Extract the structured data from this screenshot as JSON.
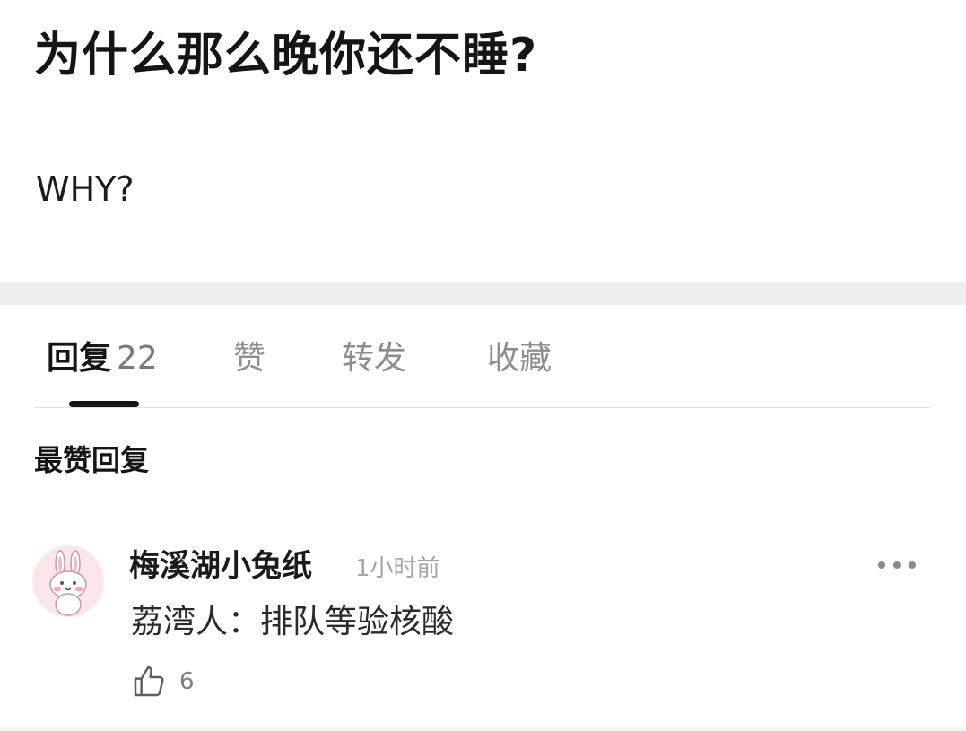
{
  "post": {
    "title": "为什么那么晚你还不睡?",
    "body": "WHY?"
  },
  "tabs": [
    {
      "label": "回复",
      "count": "22",
      "active": true
    },
    {
      "label": "赞"
    },
    {
      "label": "转发"
    },
    {
      "label": "收藏"
    }
  ],
  "section_heading": "最赞回复",
  "comment": {
    "avatar_icon": "pink-bunny-avatar",
    "author": "梅溪湖小兔纸",
    "time": "1小时前",
    "text": "荔湾人：排队等验核酸",
    "like_icon": "thumbs-up-icon",
    "likes": "6",
    "more_icon": "more-dots-icon"
  },
  "colors": {
    "text_primary": "#151515",
    "text_secondary": "#8d8d8d",
    "section_gap": "#efefef",
    "avatar_bg": "#fbe7ea"
  }
}
